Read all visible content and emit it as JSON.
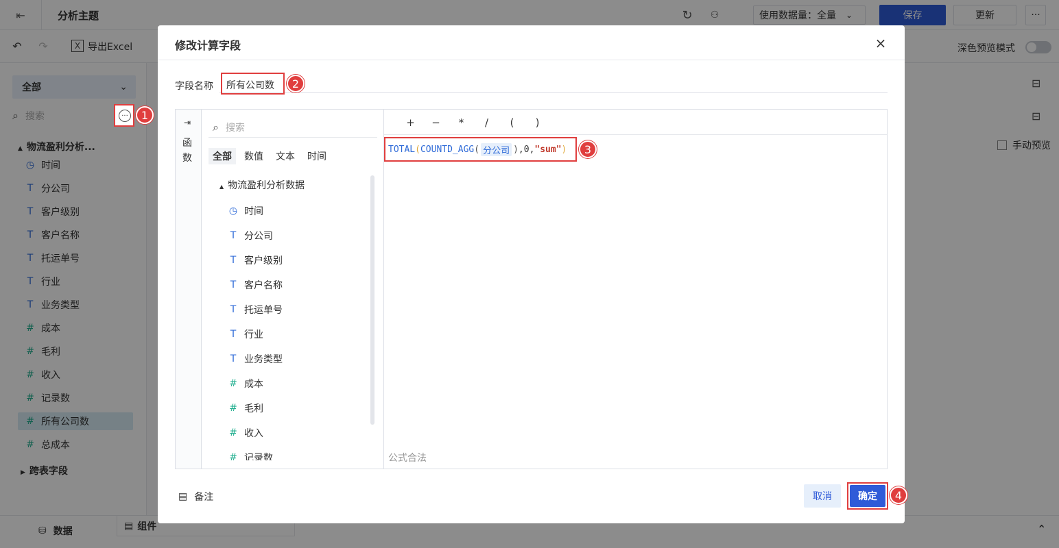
{
  "topbar": {
    "title": "分析主题",
    "data_label": "使用数据量：全量",
    "save_label": "保存",
    "update_label": "更新",
    "more_label": "···"
  },
  "toolbar": {
    "export_label": "导出Excel",
    "dark_mode_label": "深色预览模式",
    "manual_preview_label": "手动预览"
  },
  "left_panel": {
    "dataset_select": "全部",
    "search_placeholder": "搜索",
    "group_title": "物流盈利分析...",
    "fields": [
      {
        "label": "时间",
        "icon": "clock-icon"
      },
      {
        "label": "分公司",
        "icon": "text-type-icon"
      },
      {
        "label": "客户级别",
        "icon": "text-type-icon"
      },
      {
        "label": "客户名称",
        "icon": "text-type-icon"
      },
      {
        "label": "托运单号",
        "icon": "text-type-icon"
      },
      {
        "label": "行业",
        "icon": "text-type-icon"
      },
      {
        "label": "业务类型",
        "icon": "text-type-icon"
      },
      {
        "label": "成本",
        "icon": "number-type-icon"
      },
      {
        "label": "毛利",
        "icon": "number-type-icon"
      },
      {
        "label": "收入",
        "icon": "number-type-icon"
      },
      {
        "label": "记录数",
        "icon": "calc-number-icon"
      },
      {
        "label": "所有公司数",
        "icon": "calc-number-icon"
      },
      {
        "label": "总成本",
        "icon": "calc-number-icon"
      }
    ],
    "cross_table_label": "跨表字段"
  },
  "bottombar": {
    "data_tab": "数据",
    "component_tab": "组件"
  },
  "modal": {
    "title": "修改计算字段",
    "field_name_label": "字段名称",
    "field_name_value": "所有公司数",
    "function_tab": "函数",
    "search_placeholder": "搜索",
    "filter_tabs": [
      "全部",
      "数值",
      "文本",
      "时间"
    ],
    "tree_title": "物流盈利分析数据",
    "tree_fields": [
      {
        "label": "时间",
        "icon": "clock-icon"
      },
      {
        "label": "分公司",
        "icon": "text-type-icon"
      },
      {
        "label": "客户级别",
        "icon": "text-type-icon"
      },
      {
        "label": "客户名称",
        "icon": "text-type-icon"
      },
      {
        "label": "托运单号",
        "icon": "text-type-icon"
      },
      {
        "label": "行业",
        "icon": "text-type-icon"
      },
      {
        "label": "业务类型",
        "icon": "text-type-icon"
      },
      {
        "label": "成本",
        "icon": "number-type-icon"
      },
      {
        "label": "毛利",
        "icon": "number-type-icon"
      },
      {
        "label": "收入",
        "icon": "number-type-icon"
      },
      {
        "label": "记录数",
        "icon": "calc-number-icon"
      }
    ],
    "operators": [
      "+",
      "−",
      "*",
      "/",
      "(",
      ")"
    ],
    "formula": {
      "fn1": "TOTAL",
      "p1": "(",
      "fn2": "COUNTD_AGG",
      "p2": "(",
      "field": "分公司",
      "p3": ")",
      "rest": ",0,",
      "str": "\"sum\"",
      "p4": ")"
    },
    "status": "公式合法",
    "note_label": "备注",
    "cancel_label": "取消",
    "confirm_label": "确定"
  },
  "badges": [
    "1",
    "2",
    "3",
    "4"
  ],
  "colors": {
    "primary": "#2f5bd8",
    "annotation_red": "#e03e3e",
    "text_field": "#2f6bd8",
    "number_field": "#1fae8e"
  }
}
